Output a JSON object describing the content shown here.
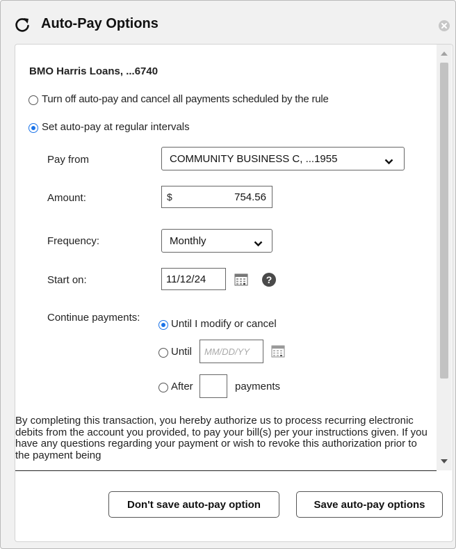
{
  "dialog": {
    "title": "Auto-Pay Options",
    "icons": {
      "refresh": "refresh-icon",
      "close": "close-icon"
    }
  },
  "account": "BMO Harris Loans, ...6740",
  "options": {
    "turn_off_label": "Turn off auto-pay and cancel all payments scheduled by the rule",
    "turn_off_selected": false,
    "set_interval_label": "Set auto-pay at regular intervals",
    "set_interval_selected": true
  },
  "form": {
    "pay_from_label": "Pay from",
    "pay_from_value": "COMMUNITY BUSINESS C, ...1955",
    "amount_label": "Amount:",
    "currency_symbol": "$",
    "amount_value": "754.56",
    "frequency_label": "Frequency:",
    "frequency_value": "Monthly",
    "start_label": "Start on:",
    "start_value": "11/12/24",
    "continue_label": "Continue payments:",
    "until_modify_label": "Until I modify or cancel",
    "until_modify_selected": true,
    "until_label": "Until",
    "until_placeholder": "MM/DD/YY",
    "until_selected": false,
    "after_label": "After",
    "after_suffix": "payments",
    "after_value": "",
    "after_selected": false
  },
  "authorization_text": "By completing this transaction, you hereby authorize us to process recurring electronic debits from the account you provided, to pay your bill(s) per your instructions given. If you have any questions regarding your payment or wish to revoke this authorization prior to the payment being",
  "buttons": {
    "dont_save": "Don't save auto-pay option",
    "save": "Save auto-pay options"
  },
  "colors": {
    "accent": "#1a73e8",
    "dialog_bg": "#f1f1f1"
  }
}
